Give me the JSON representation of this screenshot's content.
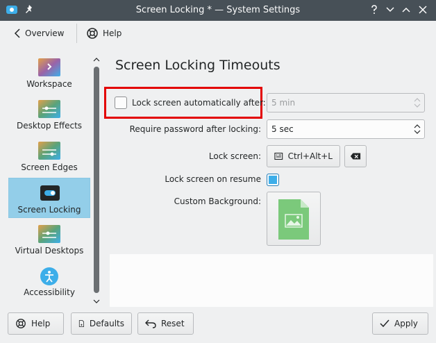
{
  "window": {
    "title": "Screen Locking * — System Settings"
  },
  "toolbar": {
    "overview_label": "Overview",
    "help_label": "Help"
  },
  "sidebar": {
    "items": [
      {
        "label": "Workspace",
        "icon": "workspace-icon"
      },
      {
        "label": "Desktop Effects",
        "icon": "desktop-effects-icon"
      },
      {
        "label": "Screen Edges",
        "icon": "screen-edges-icon"
      },
      {
        "label": "Screen Locking",
        "icon": "screen-locking-icon",
        "active": true
      },
      {
        "label": "Virtual Desktops",
        "icon": "virtual-desktops-icon"
      },
      {
        "label": "Accessibility",
        "icon": "accessibility-icon"
      }
    ]
  },
  "main": {
    "title": "Screen Locking Timeouts",
    "lock_auto": {
      "label": "Lock screen automatically after:",
      "value": "5 min",
      "checked": false
    },
    "require_password": {
      "label": "Require password after locking:",
      "value": "5 sec"
    },
    "lock_screen": {
      "label": "Lock screen:",
      "shortcut": "Ctrl+Alt+L"
    },
    "lock_on_resume": {
      "label": "Lock screen on resume",
      "checked": true
    },
    "custom_background": {
      "label": "Custom Background:"
    }
  },
  "footer": {
    "help_label": "Help",
    "defaults_label": "Defaults",
    "reset_label": "Reset",
    "apply_label": "Apply"
  },
  "colors": {
    "accent": "#3daee9",
    "selection": "#93cee9",
    "titlebar": "#475057",
    "highlight": "#e30000"
  }
}
